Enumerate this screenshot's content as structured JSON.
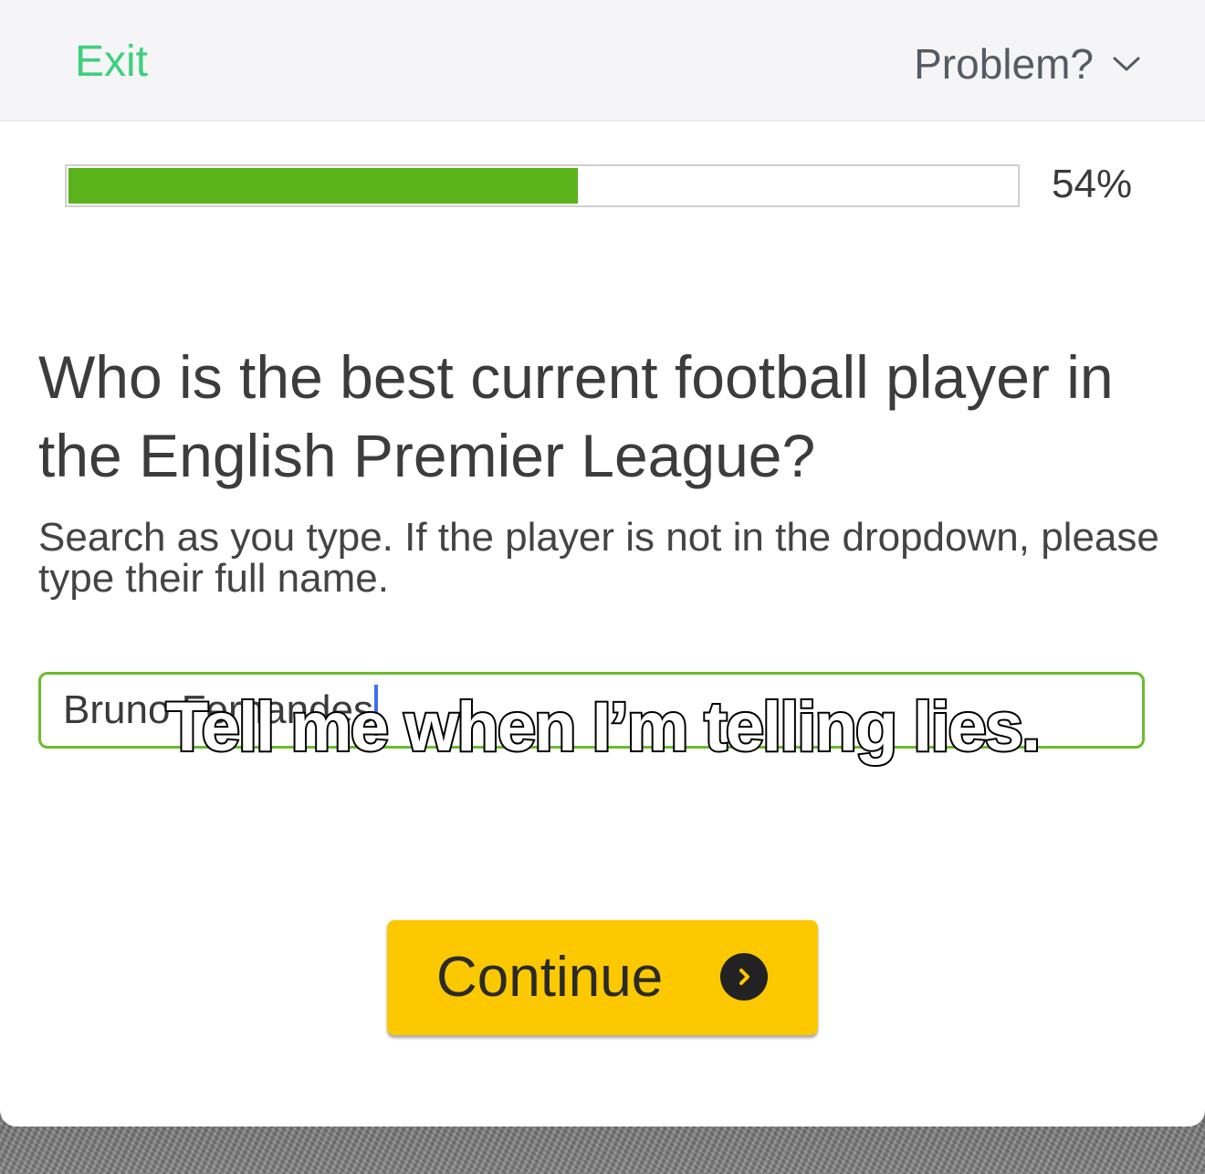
{
  "header": {
    "exit_label": "Exit",
    "problem_label": "Problem?",
    "exit_color": "#3ecf7e"
  },
  "progress": {
    "percent": 54,
    "percent_label": "54%",
    "fill_color": "#5ab31a"
  },
  "question": {
    "title": "Who is the best current football player in the English Premier League?",
    "hint": "Search as you type. If the player is not in the dropdown, please type their full name."
  },
  "answer": {
    "value": "Bruno Fernandes",
    "border_color": "#6abd2c"
  },
  "caption": {
    "text": "Tell me when I’m telling lies."
  },
  "continue_button": {
    "label": "Continue",
    "icon": "chevron-right-circle-icon",
    "color": "#fcc800"
  }
}
